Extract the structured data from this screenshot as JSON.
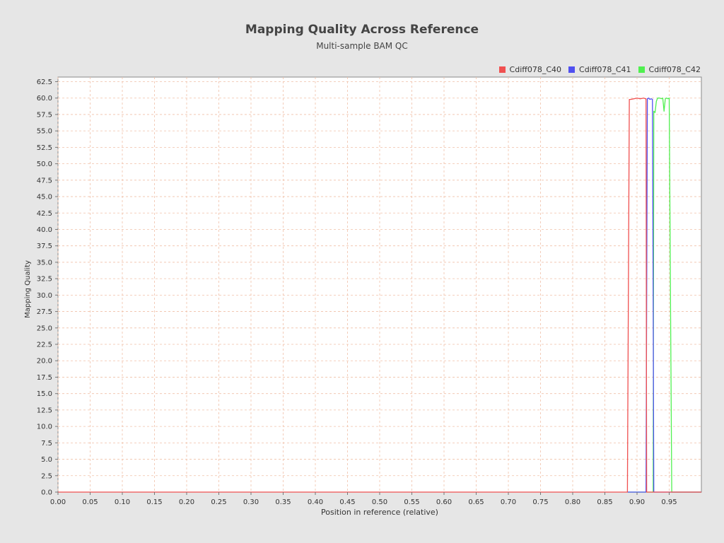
{
  "chart_data": {
    "type": "line",
    "title": "Mapping Quality Across Reference",
    "subtitle": "Multi-sample BAM QC",
    "xlabel": "Position in reference (relative)",
    "ylabel": "Mapping Quality",
    "xlim": [
      0,
      1.0
    ],
    "ylim": [
      0,
      63.2
    ],
    "xticks": [
      0.0,
      0.05,
      0.1,
      0.15,
      0.2,
      0.25,
      0.3,
      0.35,
      0.4,
      0.45,
      0.5,
      0.55,
      0.6,
      0.65,
      0.7,
      0.75,
      0.8,
      0.85,
      0.9,
      0.95
    ],
    "yticks": [
      0.0,
      2.5,
      5.0,
      7.5,
      10.0,
      12.5,
      15.0,
      17.5,
      20.0,
      22.5,
      25.0,
      27.5,
      30.0,
      32.5,
      35.0,
      37.5,
      40.0,
      42.5,
      45.0,
      47.5,
      50.0,
      52.5,
      55.0,
      57.5,
      60.0,
      62.5
    ],
    "grid": true,
    "legend_position": "top-right",
    "series": [
      {
        "name": "Cdiff078_C40",
        "color": "#f05050",
        "x": [
          0.0,
          0.885,
          0.888,
          0.89,
          0.895,
          0.9,
          0.905,
          0.91,
          0.913,
          0.914,
          0.915,
          1.0
        ],
        "y": [
          0,
          0,
          59.8,
          59.8,
          59.9,
          60.0,
          59.9,
          60.0,
          59.9,
          59.9,
          0,
          0
        ]
      },
      {
        "name": "Cdiff078_C41",
        "color": "#5050f0",
        "x": [
          0.885,
          0.914,
          0.916,
          0.918,
          0.92,
          0.922,
          0.924,
          0.925,
          0.926,
          1.0
        ],
        "y": [
          0,
          0,
          59.9,
          60.0,
          59.8,
          59.9,
          59.8,
          30,
          0,
          0
        ]
      },
      {
        "name": "Cdiff078_C42",
        "color": "#50f050",
        "x": [
          0.885,
          0.925,
          0.926,
          0.928,
          0.93,
          0.932,
          0.935,
          0.938,
          0.94,
          0.942,
          0.944,
          0.946,
          0.948,
          0.95,
          0.952,
          0.954,
          1.0
        ],
        "y": [
          0,
          0,
          58.0,
          57.8,
          59.5,
          60.0,
          60.0,
          59.9,
          60.0,
          58.0,
          59.9,
          60.0,
          59.9,
          60.0,
          30,
          0,
          0
        ]
      }
    ]
  }
}
